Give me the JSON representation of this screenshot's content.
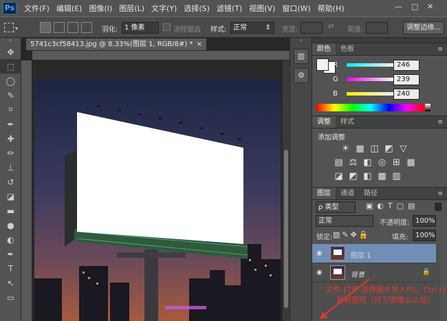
{
  "app": {
    "logo": "Ps"
  },
  "menu": [
    "文件(F)",
    "编辑(E)",
    "图像(I)",
    "图层(L)",
    "文字(Y)",
    "选择(S)",
    "滤镜(T)",
    "视图(V)",
    "窗口(W)",
    "帮助(H)"
  ],
  "window_controls": {
    "minimize": "—",
    "maximize": "□",
    "close": "✕"
  },
  "options": {
    "feather_label": "羽化:",
    "feather_value": "1 像素",
    "antialias_label": "消除锯齿",
    "style_label": "样式:",
    "style_value": "正常",
    "width_label": "宽度:",
    "height_label": "高度:",
    "refine_label": "调整边缘..."
  },
  "document": {
    "tab": "5741c3cf58413.jpg @ 8.33%(图层 1, RGB/8#) *",
    "close": "×"
  },
  "tools": [
    "move-icon",
    "marquee-icon",
    "lasso-icon",
    "quick-select-icon",
    "crop-icon",
    "eyedropper-icon",
    "healing-icon",
    "brush-icon",
    "stamp-icon",
    "history-brush-icon",
    "eraser-icon",
    "gradient-icon",
    "blur-icon",
    "dodge-icon",
    "pen-icon",
    "type-icon",
    "path-select-icon",
    "shape-icon"
  ],
  "tool_glyphs": [
    "✥",
    "⬚",
    "◯",
    "✎",
    "⌗",
    "✒",
    "✚",
    "✏",
    "⊥",
    "↺",
    "◪",
    "▬",
    "●",
    "◐",
    "✒",
    "T",
    "↖",
    "▭"
  ],
  "collapsed_icons": [
    "▥",
    "⚙"
  ],
  "color_panel": {
    "tabs": [
      "颜色",
      "色板"
    ],
    "menu": "≡",
    "channels": [
      {
        "label": "R",
        "value": "246"
      },
      {
        "label": "G",
        "value": "239"
      },
      {
        "label": "B",
        "value": "240"
      }
    ],
    "foreground": "#f6eff0",
    "background": "#ffffff"
  },
  "adjust_panel": {
    "tabs": [
      "调整",
      "样式"
    ],
    "menu": "≡",
    "heading": "添加调整",
    "row1": [
      "☀",
      "▦",
      "◫",
      "◩",
      "▽"
    ],
    "row2": [
      "▤",
      "⚖",
      "◧",
      "◎",
      "⊞",
      "▦"
    ],
    "row3": [
      "◪",
      "◩",
      "◧",
      "▩",
      "▥"
    ]
  },
  "layers_panel": {
    "tabs": [
      "图层",
      "通道",
      "路径"
    ],
    "menu": "≡",
    "kind": "ρ 类型",
    "blend_mode": "正常",
    "opacity_label": "不透明度:",
    "opacity_value": "100%",
    "lock_label": "锁定:",
    "fill_label": "填充:",
    "fill_value": "100%",
    "layers": [
      {
        "name": "图层 1",
        "visible": true,
        "selected": true
      },
      {
        "name": "背景",
        "visible": true,
        "selected": false,
        "locked": true
      }
    ]
  },
  "annotation": "文件-打开-选择图片导入PS。Ctrl+J复制图层（好习惯哦么么哒）"
}
